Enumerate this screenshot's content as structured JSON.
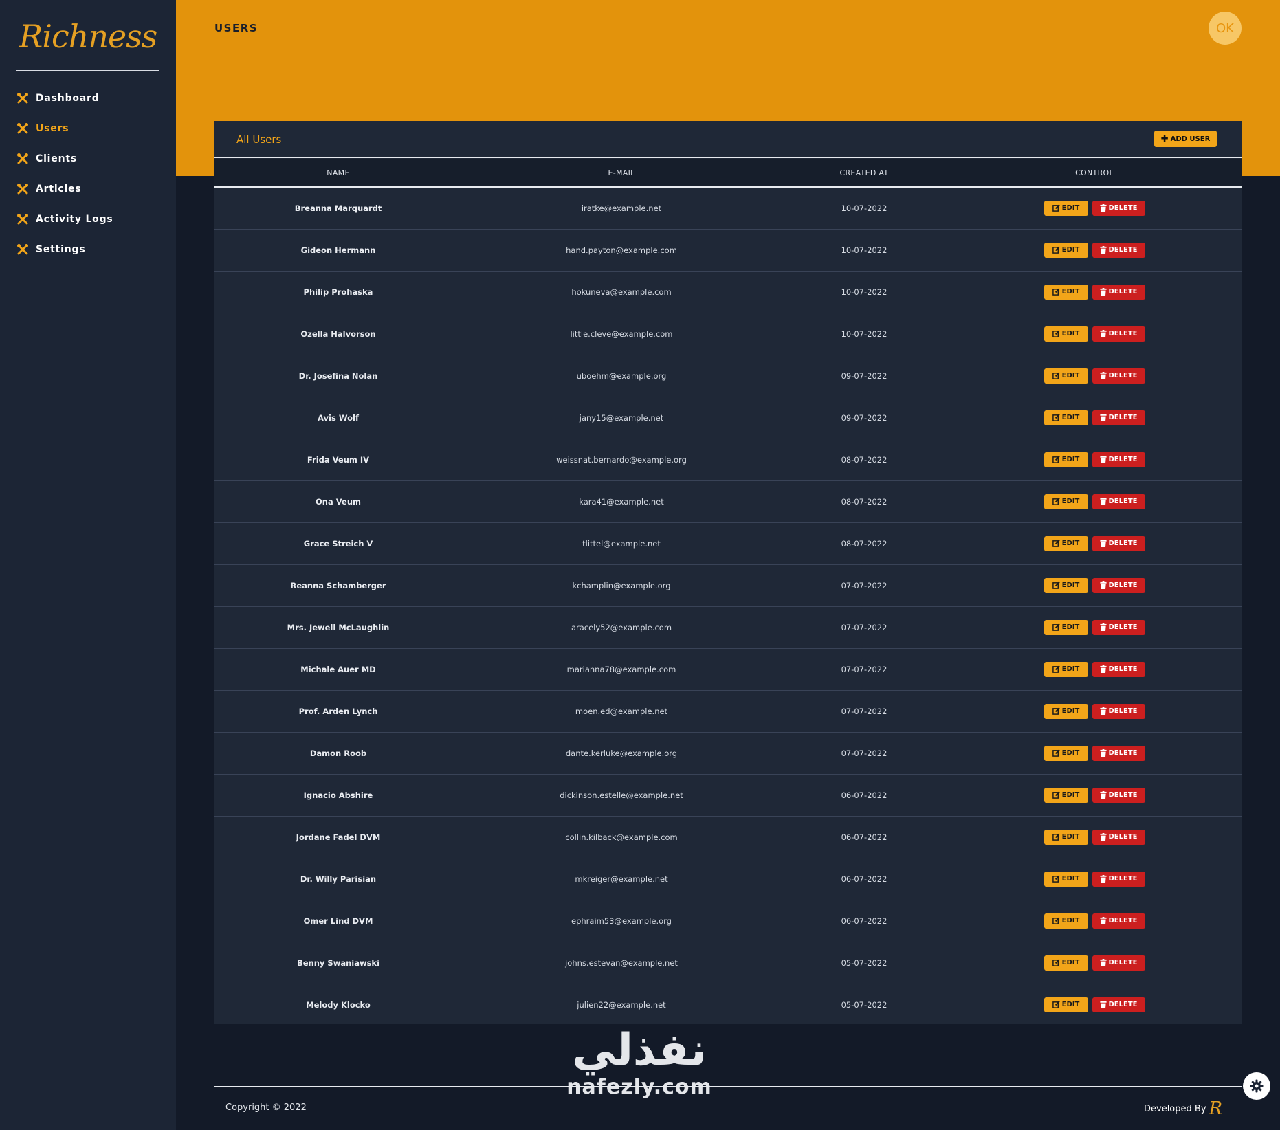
{
  "app": {
    "logo_text": "Richness"
  },
  "sidebar": {
    "items": [
      {
        "label": "Dashboard",
        "icon": "tools-icon"
      },
      {
        "label": "Users",
        "icon": "tools-icon",
        "active": true
      },
      {
        "label": "Clients",
        "icon": "tools-icon"
      },
      {
        "label": "Articles",
        "icon": "tools-icon"
      },
      {
        "label": "Activity Logs",
        "icon": "tools-icon"
      },
      {
        "label": "Settings",
        "icon": "tools-icon"
      }
    ]
  },
  "header": {
    "title": "USERS",
    "avatar_initials": "OK"
  },
  "card": {
    "title": "All Users",
    "add_button_label": "ADD USER",
    "columns": [
      "NAME",
      "E-MAIL",
      "CREATED AT",
      "CONTROL"
    ],
    "edit_label": "EDIT",
    "delete_label": "DELETE",
    "rows": [
      {
        "name": "Breanna Marquardt",
        "email": "iratke@example.net",
        "created_at": "10-07-2022"
      },
      {
        "name": "Gideon Hermann",
        "email": "hand.payton@example.com",
        "created_at": "10-07-2022"
      },
      {
        "name": "Philip Prohaska",
        "email": "hokuneva@example.com",
        "created_at": "10-07-2022"
      },
      {
        "name": "Ozella Halvorson",
        "email": "little.cleve@example.com",
        "created_at": "10-07-2022"
      },
      {
        "name": "Dr. Josefina Nolan",
        "email": "uboehm@example.org",
        "created_at": "09-07-2022"
      },
      {
        "name": "Avis Wolf",
        "email": "jany15@example.net",
        "created_at": "09-07-2022"
      },
      {
        "name": "Frida Veum IV",
        "email": "weissnat.bernardo@example.org",
        "created_at": "08-07-2022"
      },
      {
        "name": "Ona Veum",
        "email": "kara41@example.net",
        "created_at": "08-07-2022"
      },
      {
        "name": "Grace Streich V",
        "email": "tlittel@example.net",
        "created_at": "08-07-2022"
      },
      {
        "name": "Reanna Schamberger",
        "email": "kchamplin@example.org",
        "created_at": "07-07-2022"
      },
      {
        "name": "Mrs. Jewell McLaughlin",
        "email": "aracely52@example.com",
        "created_at": "07-07-2022"
      },
      {
        "name": "Michale Auer MD",
        "email": "marianna78@example.com",
        "created_at": "07-07-2022"
      },
      {
        "name": "Prof. Arden Lynch",
        "email": "moen.ed@example.net",
        "created_at": "07-07-2022"
      },
      {
        "name": "Damon Roob",
        "email": "dante.kerluke@example.org",
        "created_at": "07-07-2022"
      },
      {
        "name": "Ignacio Abshire",
        "email": "dickinson.estelle@example.net",
        "created_at": "06-07-2022"
      },
      {
        "name": "Jordane Fadel DVM",
        "email": "collin.kilback@example.com",
        "created_at": "06-07-2022"
      },
      {
        "name": "Dr. Willy Parisian",
        "email": "mkreiger@example.net",
        "created_at": "06-07-2022"
      },
      {
        "name": "Omer Lind DVM",
        "email": "ephraim53@example.org",
        "created_at": "06-07-2022"
      },
      {
        "name": "Benny Swaniawski",
        "email": "johns.estevan@example.net",
        "created_at": "05-07-2022"
      },
      {
        "name": "Melody Klocko",
        "email": "julien22@example.net",
        "created_at": "05-07-2022"
      }
    ]
  },
  "watermark": {
    "arabic": "نفذلي",
    "latin": "nafezly.com"
  },
  "footer": {
    "copyright": "Copyright © 2022",
    "developed_by": "Developed By",
    "dev_logo": "R"
  },
  "colors": {
    "accent": "#e3930c",
    "button_orange": "#f2a519",
    "danger": "#cc1f1f",
    "sidebar_bg": "#1c2535",
    "page_bg": "#131a28"
  }
}
